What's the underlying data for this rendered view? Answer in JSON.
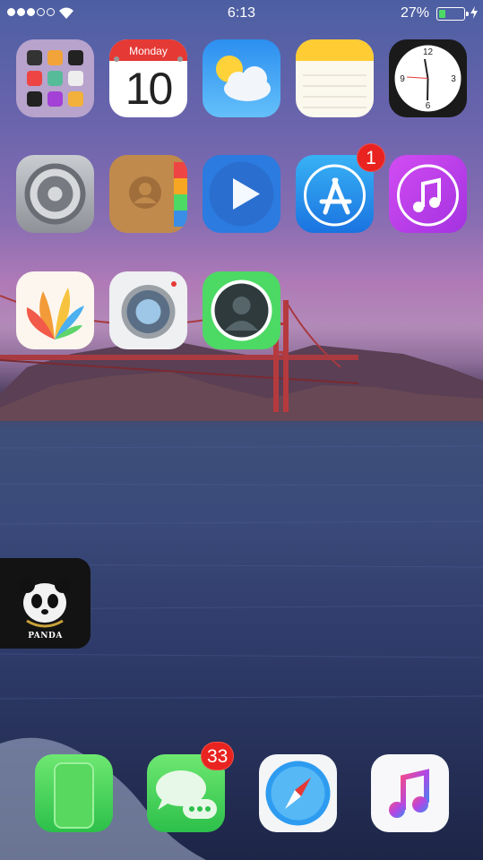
{
  "status_bar": {
    "time": "6:13",
    "battery_percent": "27%",
    "battery_level": 0.27,
    "signal_bars_filled": 3,
    "signal_bars_total": 5
  },
  "apps": {
    "calendar": {
      "weekday": "Monday",
      "date": "10"
    },
    "app_store": {
      "badge": "1"
    },
    "messages": {
      "badge": "33"
    }
  },
  "widget": {
    "album_title": "PANDA"
  },
  "colors": {
    "accent_green": "#4cd964",
    "badge_red": "#e9231f"
  }
}
